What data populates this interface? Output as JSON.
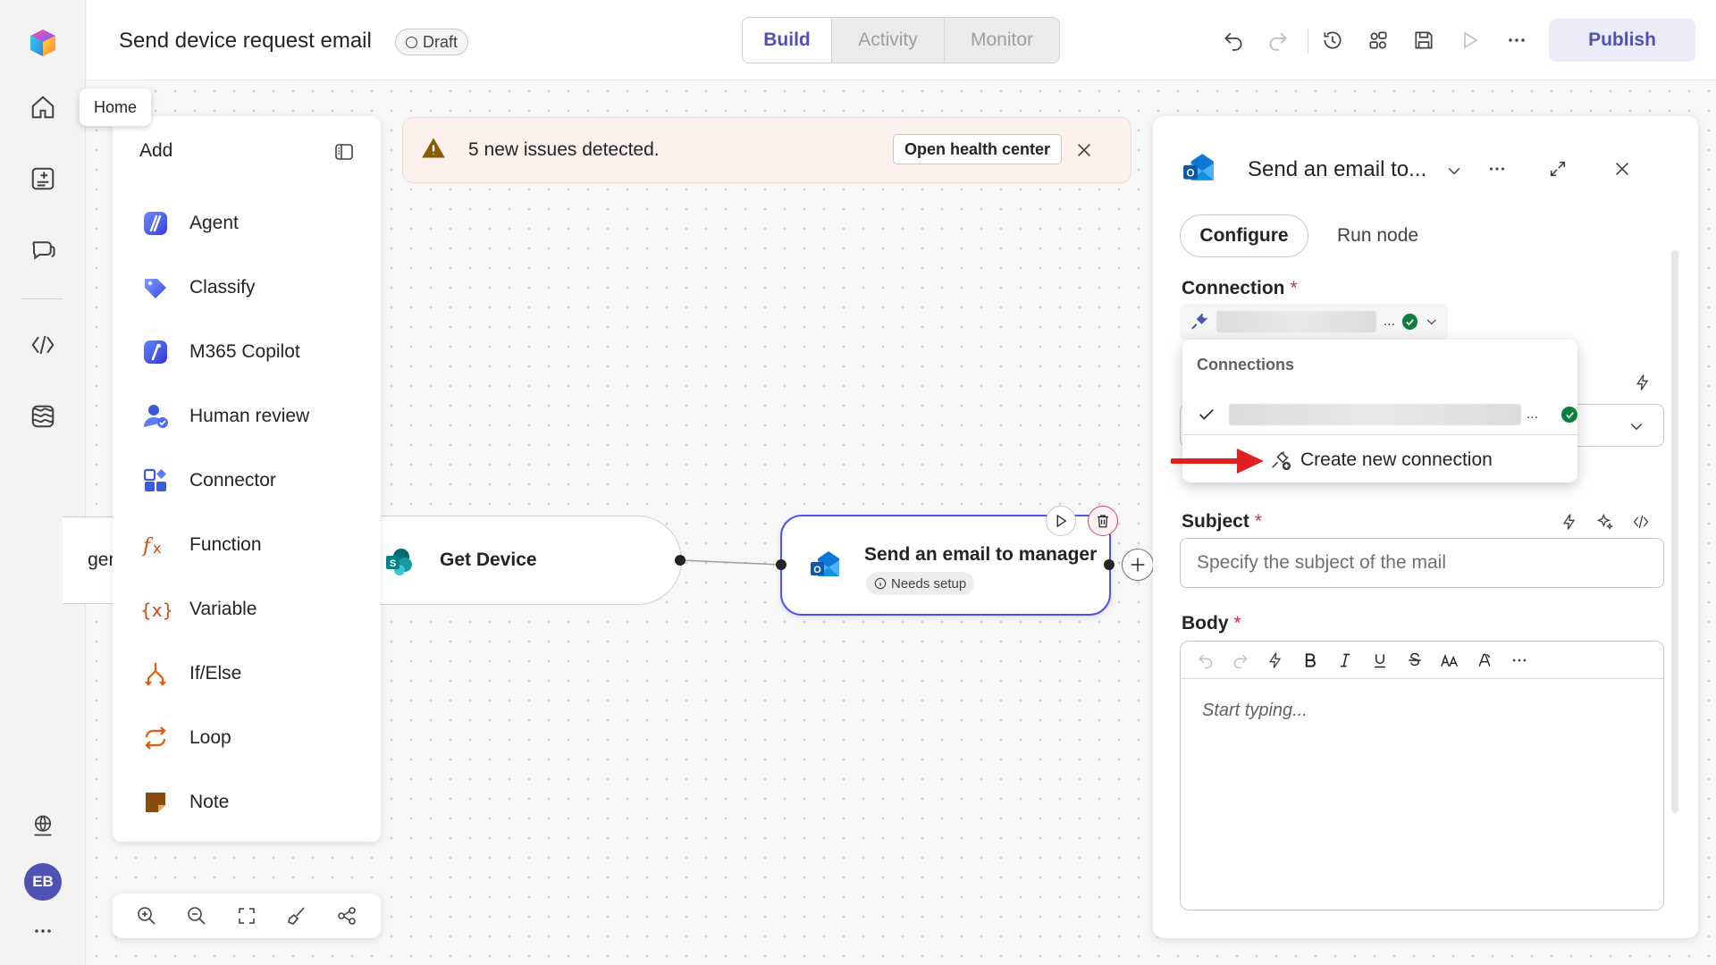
{
  "app": {
    "title": "Send device request email",
    "status_badge": "Draft",
    "tooltip": "Home",
    "avatar_initials": "EB",
    "accent_color": "#4f52b2"
  },
  "header": {
    "tabs": [
      {
        "label": "Build",
        "active": true
      },
      {
        "label": "Activity",
        "active": false
      },
      {
        "label": "Monitor",
        "active": false
      }
    ],
    "icons": [
      "undo-icon",
      "redo-icon",
      "history-icon",
      "share-icon",
      "save-icon",
      "play-icon",
      "more-icon"
    ],
    "publish_label": "Publish"
  },
  "sidebar": {
    "icons": [
      "home-icon",
      "new-app-icon",
      "chat-icon",
      "code-icon",
      "data-icon",
      "globe-icon",
      "more-icon"
    ]
  },
  "add_panel": {
    "title": "Add",
    "items": [
      {
        "label": "Agent",
        "icon": "agent-icon"
      },
      {
        "label": "Classify",
        "icon": "classify-icon"
      },
      {
        "label": "M365 Copilot",
        "icon": "m365-copilot-icon"
      },
      {
        "label": "Human review",
        "icon": "human-review-icon"
      },
      {
        "label": "Connector",
        "icon": "connector-icon"
      },
      {
        "label": "Function",
        "icon": "function-icon"
      },
      {
        "label": "Variable",
        "icon": "variable-icon"
      },
      {
        "label": "If/Else",
        "icon": "if-else-icon"
      },
      {
        "label": "Loop",
        "icon": "loop-icon"
      },
      {
        "label": "Note",
        "icon": "note-icon"
      }
    ],
    "zoom_icons": [
      "zoom-in-icon",
      "zoom-out-icon",
      "fit-view-icon",
      "clean-icon",
      "layout-icon"
    ]
  },
  "banner": {
    "text": "5 new issues detected.",
    "action_label": "Open health center"
  },
  "flow": {
    "nodes": [
      {
        "label": "gent",
        "partial": true
      },
      {
        "label": "Get Device",
        "icon": "sharepoint-icon"
      },
      {
        "label": "Send an email to manager",
        "icon": "outlook-icon",
        "status": "Needs setup",
        "selected": true
      }
    ]
  },
  "properties": {
    "title": "Send an email to...",
    "tabs": [
      {
        "label": "Configure",
        "active": true
      },
      {
        "label": "Run node",
        "active": false
      }
    ],
    "connection_label": "Connection",
    "subject_label": "Subject",
    "subject_placeholder": "Specify the subject of the mail",
    "body_label": "Body",
    "body_placeholder": "Start typing...",
    "required_mark": "*",
    "body_toolbar": [
      "undo-icon",
      "redo-icon",
      "dynamic-content-icon",
      "bold-icon",
      "italic-icon",
      "underline-icon",
      "strikethrough-icon",
      "font-size-icon",
      "font-color-icon",
      "more-icon"
    ]
  },
  "connections_dropdown": {
    "title": "Connections",
    "create_label": "Create new connection",
    "ellipsis": "..."
  }
}
